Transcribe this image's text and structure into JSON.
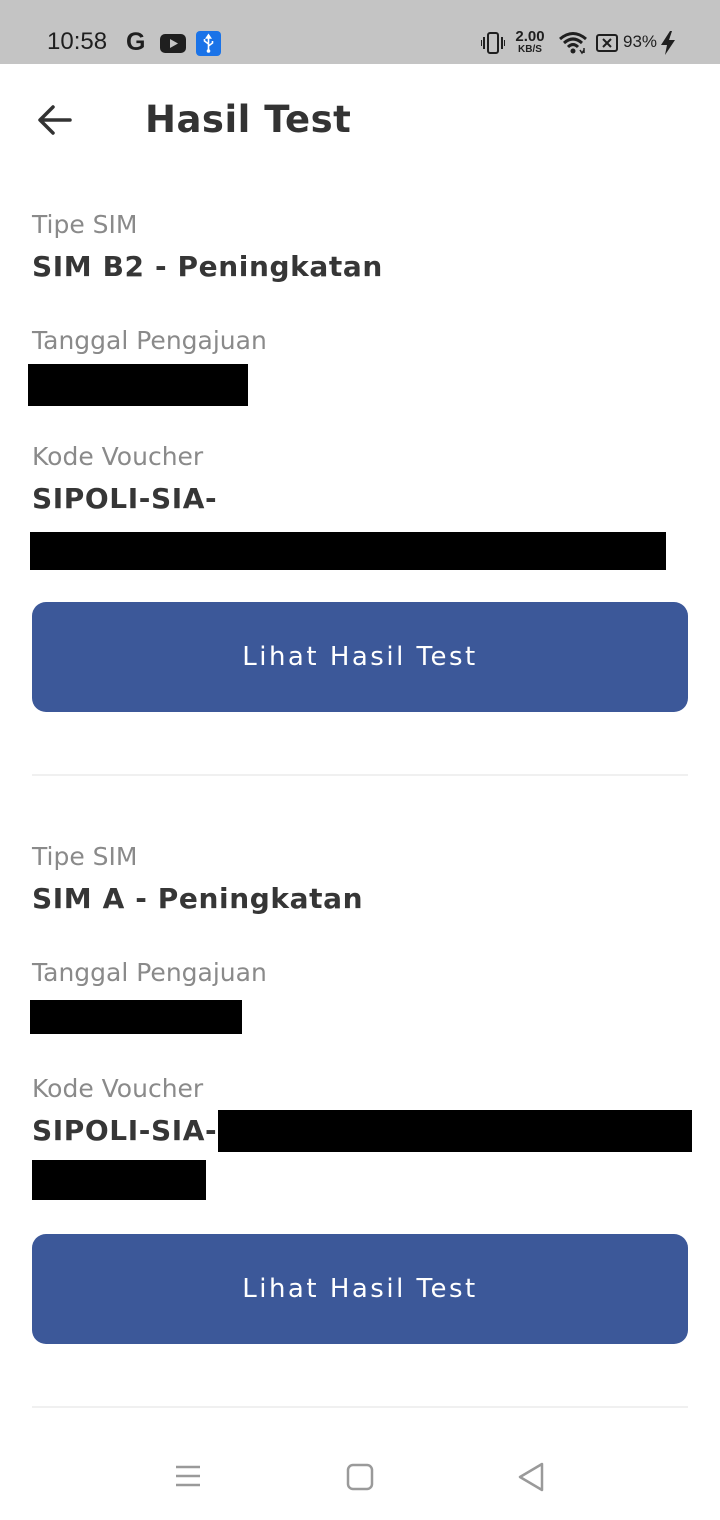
{
  "status_bar": {
    "time": "10:58",
    "g_icon_text": "G",
    "net_speed_value": "2.00",
    "net_speed_unit": "KB/S",
    "battery_percent": "93%"
  },
  "app_bar": {
    "title": "Hasil Test",
    "back_icon": "arrow-left-icon"
  },
  "results": [
    {
      "tipe_label": "Tipe SIM",
      "tipe_value": "SIM B2 - Peningkatan",
      "tanggal_label": "Tanggal Pengajuan",
      "kode_label": "Kode Voucher",
      "kode_value": "SIPOLI-SIA-",
      "button_label": "Lihat Hasil Test"
    },
    {
      "tipe_label": "Tipe SIM",
      "tipe_value": "SIM A - Peningkatan",
      "tanggal_label": "Tanggal Pengajuan",
      "kode_label": "Kode Voucher",
      "kode_value": "SIPOLI-SIA-",
      "button_label": "Lihat Hasil Test"
    }
  ],
  "colors": {
    "primary_button": "#3c5899",
    "status_bar": "#c4c4c4"
  },
  "nav_bar": {
    "icons": [
      "menu-icon",
      "home-square-icon",
      "back-triangle-icon"
    ]
  }
}
